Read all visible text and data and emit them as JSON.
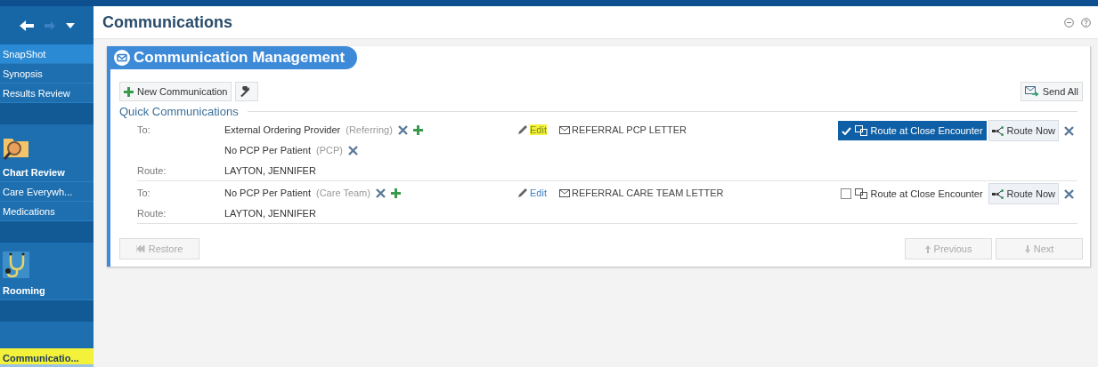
{
  "nav": {
    "items": [
      {
        "kind": "link",
        "label": "SnapShot",
        "selected": true,
        "highlighted": false
      },
      {
        "kind": "link",
        "label": "Synopsis",
        "selected": false,
        "highlighted": false
      },
      {
        "kind": "link",
        "label": "Results Review",
        "selected": false,
        "highlighted": false
      },
      {
        "kind": "spacer"
      },
      {
        "kind": "tile",
        "label": "Chart Review",
        "selected": false,
        "highlighted": false
      },
      {
        "kind": "link",
        "label": "Care Everywh...",
        "selected": false,
        "highlighted": false
      },
      {
        "kind": "link",
        "label": "Medications",
        "selected": false,
        "highlighted": false
      },
      {
        "kind": "spacer"
      },
      {
        "kind": "tile",
        "label": "Rooming",
        "selected": false,
        "highlighted": false
      },
      {
        "kind": "spacer"
      },
      {
        "kind": "link",
        "label": "Communicatio...",
        "selected": true,
        "highlighted": true
      }
    ]
  },
  "header": {
    "title": "Communications"
  },
  "card": {
    "title": "Communication Management",
    "new_button": "New Communication",
    "send_all": "Send All",
    "section_title": "Quick Communications",
    "communications": [
      {
        "to_label": "To:",
        "recipients": [
          {
            "name": "External Ordering Provider",
            "role": "(Referring)",
            "addable": true
          },
          {
            "name": "No PCP Per Patient",
            "role": "(PCP)",
            "addable": false
          }
        ],
        "edit": "Edit",
        "edit_highlighted": true,
        "letter": "REFERRAL PCP LETTER",
        "route_at_close": "Route at Close Encounter",
        "route_at_close_checked": true,
        "route_now": "Route Now",
        "route_label": "Route:",
        "route_to": "LAYTON, JENNIFER"
      },
      {
        "to_label": "To:",
        "recipients": [
          {
            "name": "No PCP Per Patient",
            "role": "(Care Team)",
            "addable": true
          }
        ],
        "edit": "Edit",
        "edit_highlighted": false,
        "letter": "REFERRAL CARE TEAM LETTER",
        "route_at_close": "Route at Close Encounter",
        "route_at_close_checked": false,
        "route_now": "Route Now",
        "route_label": "Route:",
        "route_to": "LAYTON, JENNIFER"
      }
    ],
    "restore": "Restore",
    "previous": "Previous",
    "next": "Next"
  }
}
